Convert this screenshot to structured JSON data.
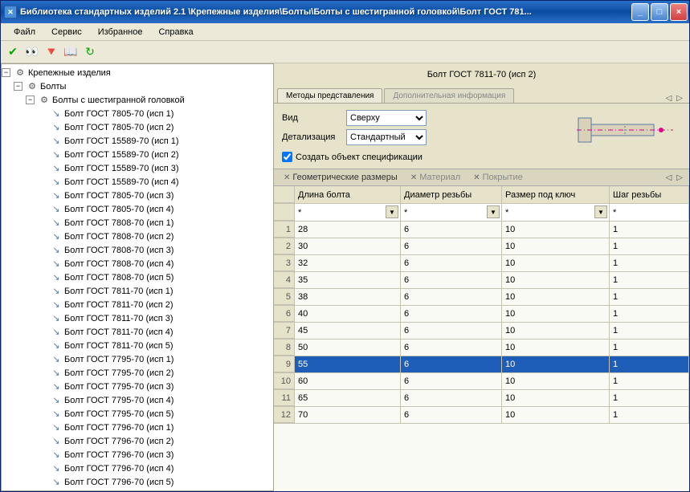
{
  "title": "Библиотека стандартных изделий 2.1 \\Крепежные изделия\\Болты\\Болты с шестигранной головкой\\Болт ГОСТ 781...",
  "menu": {
    "file": "Файл",
    "service": "Сервис",
    "favorites": "Избранное",
    "help": "Справка"
  },
  "tree": {
    "root": "Крепежные изделия",
    "bolts": "Болты",
    "hex": "Болты с шестигранной головкой",
    "items": [
      "Болт ГОСТ 7805-70 (исп 1)",
      "Болт ГОСТ 7805-70 (исп 2)",
      "Болт ГОСТ 15589-70 (исп 1)",
      "Болт ГОСТ 15589-70 (исп 2)",
      "Болт ГОСТ 15589-70 (исп 3)",
      "Болт ГОСТ 15589-70 (исп 4)",
      "Болт ГОСТ 7805-70 (исп 3)",
      "Болт ГОСТ 7805-70 (исп 4)",
      "Болт ГОСТ 7808-70 (исп 1)",
      "Болт ГОСТ 7808-70 (исп 2)",
      "Болт ГОСТ 7808-70 (исп 3)",
      "Болт ГОСТ 7808-70 (исп 4)",
      "Болт ГОСТ 7808-70 (исп 5)",
      "Болт ГОСТ 7811-70 (исп 1)",
      "Болт ГОСТ 7811-70 (исп 2)",
      "Болт ГОСТ 7811-70 (исп 3)",
      "Болт ГОСТ 7811-70 (исп 4)",
      "Болт ГОСТ 7811-70 (исп 5)",
      "Болт ГОСТ 7795-70 (исп 1)",
      "Болт ГОСТ 7795-70 (исп 2)",
      "Болт ГОСТ 7795-70 (исп 3)",
      "Болт ГОСТ 7795-70 (исп 4)",
      "Болт ГОСТ 7795-70 (исп 5)",
      "Болт ГОСТ 7796-70 (исп 1)",
      "Болт ГОСТ 7796-70 (исп 2)",
      "Болт ГОСТ 7796-70 (исп 3)",
      "Болт ГОСТ 7796-70 (исп 4)",
      "Болт ГОСТ 7796-70 (исп 5)"
    ]
  },
  "heading": "Болт ГОСТ 7811-70 (исп 2)",
  "tabs1": {
    "methods": "Методы представления",
    "extra": "Дополнительная информация"
  },
  "params": {
    "view_label": "Вид",
    "view_value": "Сверху",
    "detail_label": "Детализация",
    "detail_value": "Стандартный",
    "checkbox": "Создать объект спецификации",
    "checked": true
  },
  "tabs2": {
    "geom": "Геометрические размеры",
    "material": "Материал",
    "coating": "Покрытие"
  },
  "grid": {
    "cols": [
      "Длина болта",
      "Диаметр резьбы",
      "Размер под ключ",
      "Шаг резьбы"
    ],
    "filter": "*",
    "rows": [
      {
        "n": 1,
        "len": 28,
        "dia": 6,
        "key": 10,
        "pitch": 1
      },
      {
        "n": 2,
        "len": 30,
        "dia": 6,
        "key": 10,
        "pitch": 1
      },
      {
        "n": 3,
        "len": 32,
        "dia": 6,
        "key": 10,
        "pitch": 1
      },
      {
        "n": 4,
        "len": 35,
        "dia": 6,
        "key": 10,
        "pitch": 1
      },
      {
        "n": 5,
        "len": 38,
        "dia": 6,
        "key": 10,
        "pitch": 1
      },
      {
        "n": 6,
        "len": 40,
        "dia": 6,
        "key": 10,
        "pitch": 1
      },
      {
        "n": 7,
        "len": 45,
        "dia": 6,
        "key": 10,
        "pitch": 1
      },
      {
        "n": 8,
        "len": 50,
        "dia": 6,
        "key": 10,
        "pitch": 1
      },
      {
        "n": 9,
        "len": 55,
        "dia": 6,
        "key": 10,
        "pitch": 1
      },
      {
        "n": 10,
        "len": 60,
        "dia": 6,
        "key": 10,
        "pitch": 1
      },
      {
        "n": 11,
        "len": 65,
        "dia": 6,
        "key": 10,
        "pitch": 1
      },
      {
        "n": 12,
        "len": 70,
        "dia": 6,
        "key": 10,
        "pitch": 1
      }
    ],
    "selected": 9
  }
}
